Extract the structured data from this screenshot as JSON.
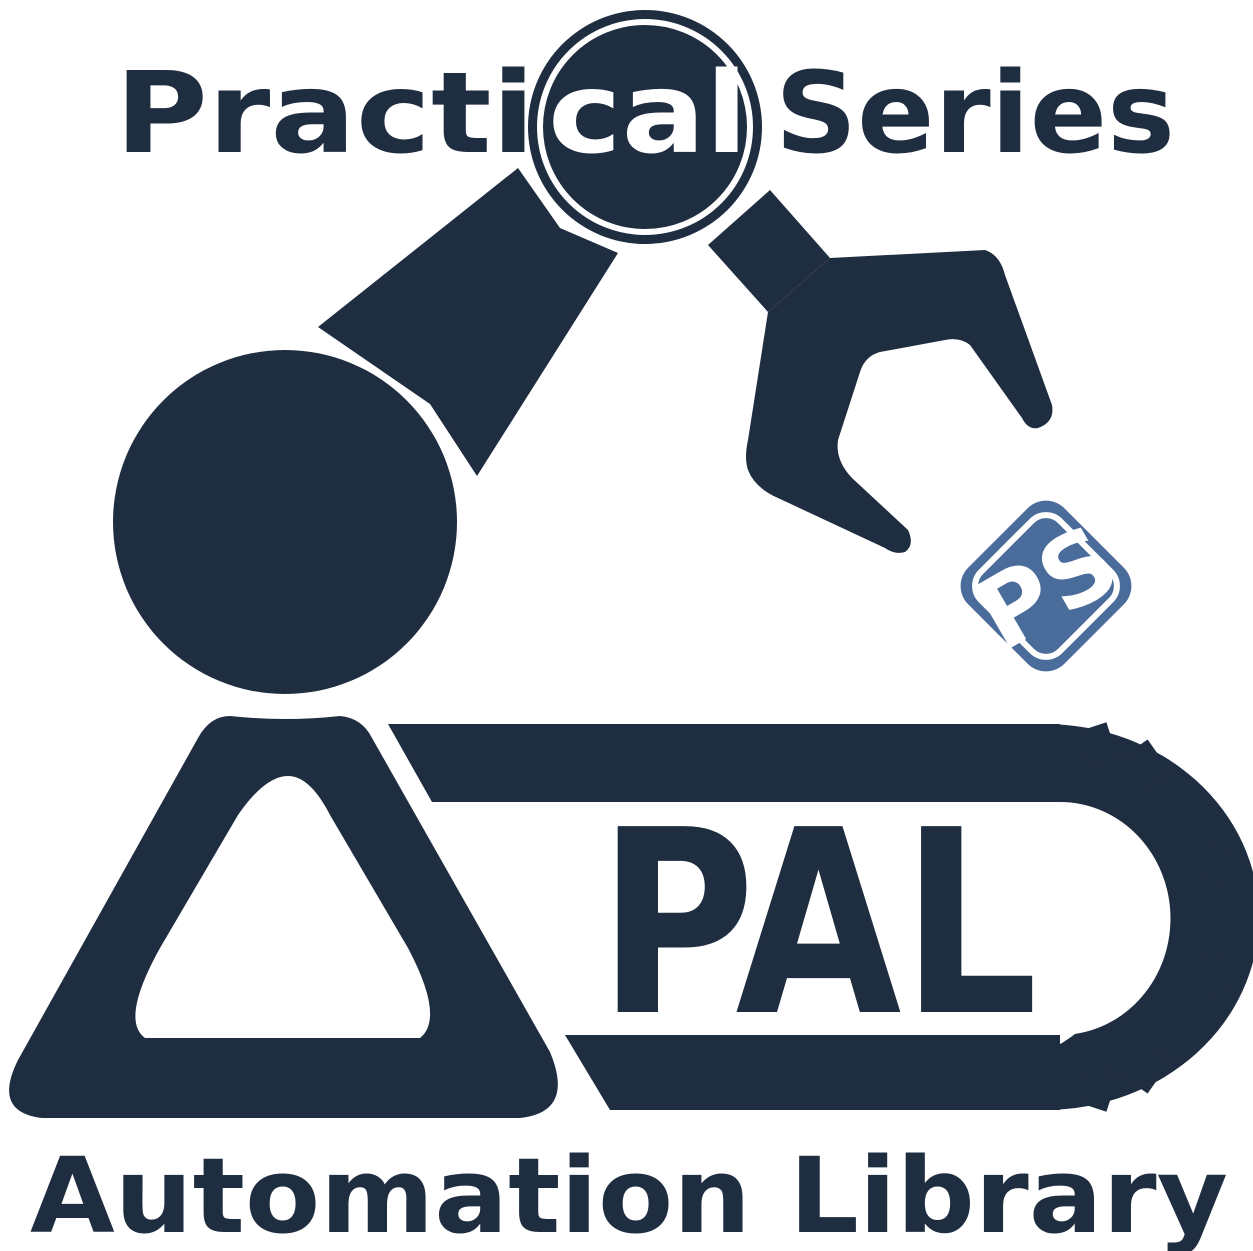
{
  "logo": {
    "title_part1": "Practi",
    "title_highlight": "cal",
    "title_part2": "Series",
    "badge_text": "PS",
    "core_text": "PAL",
    "subtitle": "Automation Library"
  },
  "colors": {
    "navy": "#1f2d40",
    "blue": "#4a6c9b",
    "white": "#ffffff"
  },
  "icons": [
    "robot-arm-icon",
    "gripper-icon",
    "gear-icon",
    "conveyor-icon",
    "ps-badge-icon"
  ]
}
